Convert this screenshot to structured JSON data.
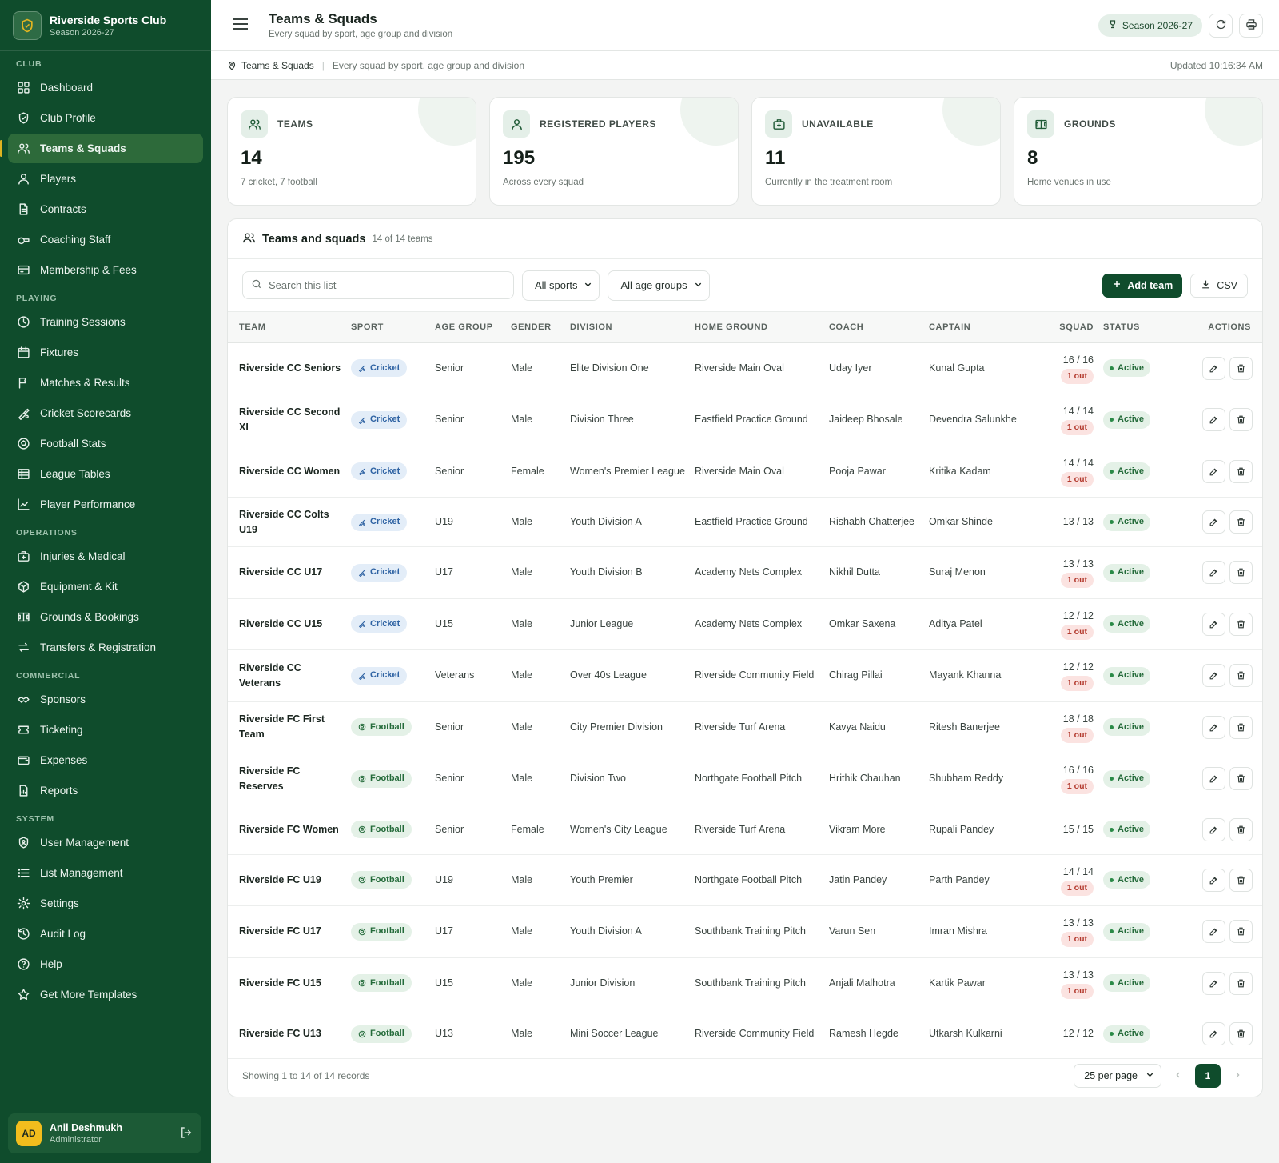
{
  "brand": {
    "name": "Riverside Sports Club",
    "season": "Season 2026-27"
  },
  "sidebar": {
    "sections": [
      {
        "label": "CLUB",
        "items": [
          {
            "label": "Dashboard",
            "icon": "dashboard-icon"
          },
          {
            "label": "Club Profile",
            "icon": "shield-icon"
          },
          {
            "label": "Teams & Squads",
            "icon": "users-icon",
            "active": true
          },
          {
            "label": "Players",
            "icon": "user-icon"
          },
          {
            "label": "Contracts",
            "icon": "document-icon"
          },
          {
            "label": "Coaching Staff",
            "icon": "whistle-icon"
          },
          {
            "label": "Membership & Fees",
            "icon": "card-icon"
          }
        ]
      },
      {
        "label": "PLAYING",
        "items": [
          {
            "label": "Training Sessions",
            "icon": "clock-icon"
          },
          {
            "label": "Fixtures",
            "icon": "calendar-icon"
          },
          {
            "label": "Matches & Results",
            "icon": "flag-icon"
          },
          {
            "label": "Cricket Scorecards",
            "icon": "cricket-icon"
          },
          {
            "label": "Football Stats",
            "icon": "football-icon"
          },
          {
            "label": "League Tables",
            "icon": "table-icon"
          },
          {
            "label": "Player Performance",
            "icon": "chart-line-icon"
          }
        ]
      },
      {
        "label": "OPERATIONS",
        "items": [
          {
            "label": "Injuries & Medical",
            "icon": "medkit-icon"
          },
          {
            "label": "Equipment & Kit",
            "icon": "box-icon"
          },
          {
            "label": "Grounds & Bookings",
            "icon": "field-icon"
          },
          {
            "label": "Transfers & Registration",
            "icon": "transfer-icon"
          }
        ]
      },
      {
        "label": "COMMERCIAL",
        "items": [
          {
            "label": "Sponsors",
            "icon": "handshake-icon"
          },
          {
            "label": "Ticketing",
            "icon": "ticket-icon"
          },
          {
            "label": "Expenses",
            "icon": "wallet-icon"
          },
          {
            "label": "Reports",
            "icon": "report-icon"
          }
        ]
      },
      {
        "label": "SYSTEM",
        "items": [
          {
            "label": "User Management",
            "icon": "user-shield-icon"
          },
          {
            "label": "List Management",
            "icon": "list-icon"
          },
          {
            "label": "Settings",
            "icon": "gear-icon"
          },
          {
            "label": "Audit Log",
            "icon": "history-icon"
          },
          {
            "label": "Help",
            "icon": "help-icon"
          },
          {
            "label": "Get More Templates",
            "icon": "star-icon"
          }
        ]
      }
    ]
  },
  "user": {
    "initials": "AD",
    "name": "Anil Deshmukh",
    "role": "Administrator"
  },
  "header": {
    "title": "Teams & Squads",
    "subtitle": "Every squad by sport, age group and division",
    "season_pill": "Season 2026-27"
  },
  "crumb": {
    "current": "Teams & Squads",
    "description": "Every squad by sport, age group and division",
    "updated": "Updated 10:16:34 AM"
  },
  "kpis": [
    {
      "label": "TEAMS",
      "value": "14",
      "note": "7 cricket, 7 football",
      "icon": "users-icon"
    },
    {
      "label": "REGISTERED PLAYERS",
      "value": "195",
      "note": "Across every squad",
      "icon": "user-icon"
    },
    {
      "label": "UNAVAILABLE",
      "value": "11",
      "note": "Currently in the treatment room",
      "icon": "medkit-icon"
    },
    {
      "label": "GROUNDS",
      "value": "8",
      "note": "Home venues in use",
      "icon": "field-icon"
    }
  ],
  "panel": {
    "title": "Teams and squads",
    "count": "14 of 14 teams",
    "search_placeholder": "Search this list",
    "sport_filter": "All sports",
    "age_filter": "All age groups",
    "add_label": "Add team",
    "csv_label": "CSV"
  },
  "table": {
    "headers": [
      "TEAM",
      "SPORT",
      "AGE GROUP",
      "GENDER",
      "DIVISION",
      "HOME GROUND",
      "COACH",
      "CAPTAIN",
      "SQUAD",
      "STATUS",
      "ACTIONS"
    ],
    "rows": [
      {
        "team": "Riverside CC Seniors",
        "sport": "Cricket",
        "age": "Senior",
        "gender": "Male",
        "division": "Elite Division One",
        "ground": "Riverside Main Oval",
        "coach": "Uday Iyer",
        "captain": "Kunal Gupta",
        "squad": "16 / 16",
        "out": "1 out",
        "status": "Active"
      },
      {
        "team": "Riverside CC Second XI",
        "sport": "Cricket",
        "age": "Senior",
        "gender": "Male",
        "division": "Division Three",
        "ground": "Eastfield Practice Ground",
        "coach": "Jaideep Bhosale",
        "captain": "Devendra Salunkhe",
        "squad": "14 / 14",
        "out": "1 out",
        "status": "Active"
      },
      {
        "team": "Riverside CC Women",
        "sport": "Cricket",
        "age": "Senior",
        "gender": "Female",
        "division": "Women's Premier League",
        "ground": "Riverside Main Oval",
        "coach": "Pooja Pawar",
        "captain": "Kritika Kadam",
        "squad": "14 / 14",
        "out": "1 out",
        "status": "Active"
      },
      {
        "team": "Riverside CC Colts U19",
        "sport": "Cricket",
        "age": "U19",
        "gender": "Male",
        "division": "Youth Division A",
        "ground": "Eastfield Practice Ground",
        "coach": "Rishabh Chatterjee",
        "captain": "Omkar Shinde",
        "squad": "13 / 13",
        "out": "",
        "status": "Active"
      },
      {
        "team": "Riverside CC U17",
        "sport": "Cricket",
        "age": "U17",
        "gender": "Male",
        "division": "Youth Division B",
        "ground": "Academy Nets Complex",
        "coach": "Nikhil Dutta",
        "captain": "Suraj Menon",
        "squad": "13 / 13",
        "out": "1 out",
        "status": "Active"
      },
      {
        "team": "Riverside CC U15",
        "sport": "Cricket",
        "age": "U15",
        "gender": "Male",
        "division": "Junior League",
        "ground": "Academy Nets Complex",
        "coach": "Omkar Saxena",
        "captain": "Aditya Patel",
        "squad": "12 / 12",
        "out": "1 out",
        "status": "Active"
      },
      {
        "team": "Riverside CC Veterans",
        "sport": "Cricket",
        "age": "Veterans",
        "gender": "Male",
        "division": "Over 40s League",
        "ground": "Riverside Community Field",
        "coach": "Chirag Pillai",
        "captain": "Mayank Khanna",
        "squad": "12 / 12",
        "out": "1 out",
        "status": "Active"
      },
      {
        "team": "Riverside FC First Team",
        "sport": "Football",
        "age": "Senior",
        "gender": "Male",
        "division": "City Premier Division",
        "ground": "Riverside Turf Arena",
        "coach": "Kavya Naidu",
        "captain": "Ritesh Banerjee",
        "squad": "18 / 18",
        "out": "1 out",
        "status": "Active"
      },
      {
        "team": "Riverside FC Reserves",
        "sport": "Football",
        "age": "Senior",
        "gender": "Male",
        "division": "Division Two",
        "ground": "Northgate Football Pitch",
        "coach": "Hrithik Chauhan",
        "captain": "Shubham Reddy",
        "squad": "16 / 16",
        "out": "1 out",
        "status": "Active"
      },
      {
        "team": "Riverside FC Women",
        "sport": "Football",
        "age": "Senior",
        "gender": "Female",
        "division": "Women's City League",
        "ground": "Riverside Turf Arena",
        "coach": "Vikram More",
        "captain": "Rupali Pandey",
        "squad": "15 / 15",
        "out": "",
        "status": "Active"
      },
      {
        "team": "Riverside FC U19",
        "sport": "Football",
        "age": "U19",
        "gender": "Male",
        "division": "Youth Premier",
        "ground": "Northgate Football Pitch",
        "coach": "Jatin Pandey",
        "captain": "Parth Pandey",
        "squad": "14 / 14",
        "out": "1 out",
        "status": "Active"
      },
      {
        "team": "Riverside FC U17",
        "sport": "Football",
        "age": "U17",
        "gender": "Male",
        "division": "Youth Division A",
        "ground": "Southbank Training Pitch",
        "coach": "Varun Sen",
        "captain": "Imran Mishra",
        "squad": "13 / 13",
        "out": "1 out",
        "status": "Active"
      },
      {
        "team": "Riverside FC U15",
        "sport": "Football",
        "age": "U15",
        "gender": "Male",
        "division": "Junior Division",
        "ground": "Southbank Training Pitch",
        "coach": "Anjali Malhotra",
        "captain": "Kartik Pawar",
        "squad": "13 / 13",
        "out": "1 out",
        "status": "Active"
      },
      {
        "team": "Riverside FC U13",
        "sport": "Football",
        "age": "U13",
        "gender": "Male",
        "division": "Mini Soccer League",
        "ground": "Riverside Community Field",
        "coach": "Ramesh Hegde",
        "captain": "Utkarsh Kulkarni",
        "squad": "12 / 12",
        "out": "",
        "status": "Active"
      }
    ]
  },
  "footer": {
    "showing": "Showing 1 to 14 of 14 records",
    "per_page": "25 per page",
    "page": "1"
  }
}
